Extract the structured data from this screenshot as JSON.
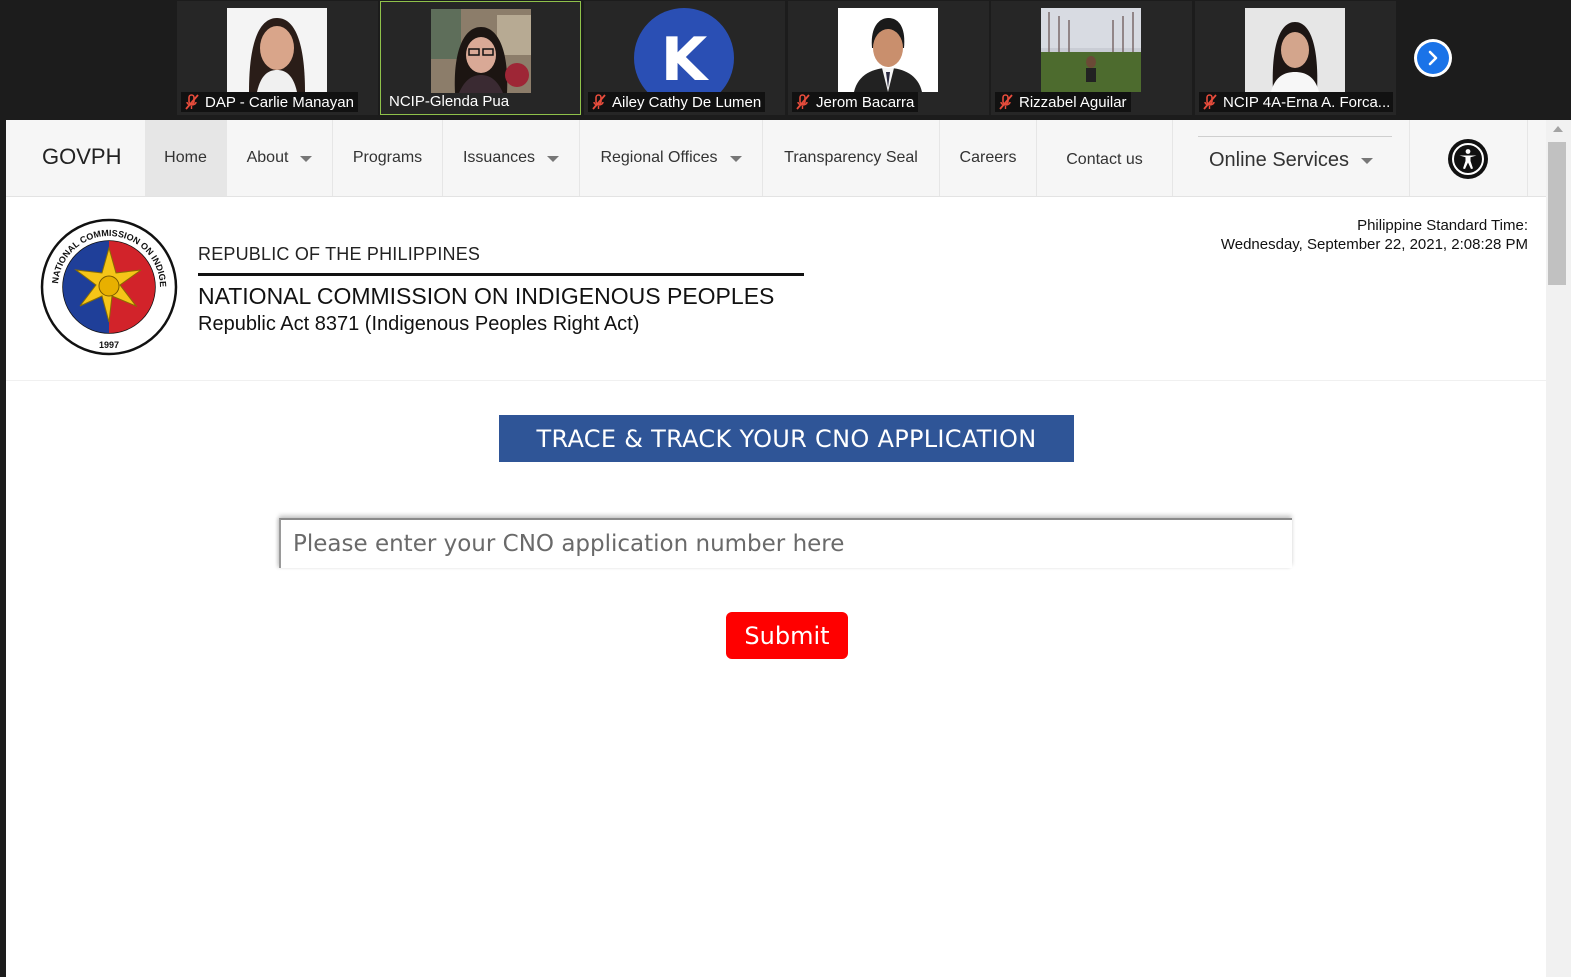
{
  "meeting": {
    "participants": [
      {
        "name": "DAP - Carlie Manayan",
        "muted": true,
        "active": false,
        "avatar": "photo"
      },
      {
        "name": "NCIP-Glenda Pua",
        "muted": false,
        "active": true,
        "avatar": "photo"
      },
      {
        "name": "Ailey Cathy De Lumen",
        "muted": true,
        "active": false,
        "avatar": "initial",
        "initial": "K",
        "initial_color": "#2a4fb4"
      },
      {
        "name": "Jerom Bacarra",
        "muted": true,
        "active": false,
        "avatar": "photo"
      },
      {
        "name": "Rizzabel Aguilar",
        "muted": true,
        "active": false,
        "avatar": "photo"
      },
      {
        "name": "NCIP 4A-Erna A. Forca...",
        "muted": true,
        "active": false,
        "avatar": "photo"
      }
    ],
    "next_icon": "chevron-right-icon"
  },
  "nav": {
    "brand": "GOVPH",
    "home": "Home",
    "about": "About",
    "programs": "Programs",
    "issuances": "Issuances",
    "regional_offices": "Regional Offices",
    "transparency_seal": "Transparency Seal",
    "careers": "Careers",
    "contact_us": "Contact us",
    "online_services": "Online Services",
    "accessibility_icon": "accessibility-icon"
  },
  "header": {
    "republic": "REPUBLIC OF THE PHILIPPINES",
    "commission": "NATIONAL COMMISSION ON INDIGENOUS PEOPLES",
    "act": "Republic Act 8371 (Indigenous Peoples Right Act)",
    "seal_text": "NATIONAL COMMISSION ON INDIGENOUS PEOPLES",
    "seal_year": "1997",
    "pst_label": "Philippine Standard Time:",
    "pst_value": "Wednesday, September 22, 2021, 2:08:28 PM"
  },
  "tracker": {
    "title": "TRACE & TRACK YOUR CNO APPLICATION",
    "input_value": "",
    "input_placeholder": "Please enter your CNO application number here",
    "submit_label": "Submit"
  },
  "colors": {
    "banner": "#2f5597",
    "submit": "#ff0000",
    "active_tile_border": "#8fc14a",
    "mic_muted": "#e74c3c"
  }
}
